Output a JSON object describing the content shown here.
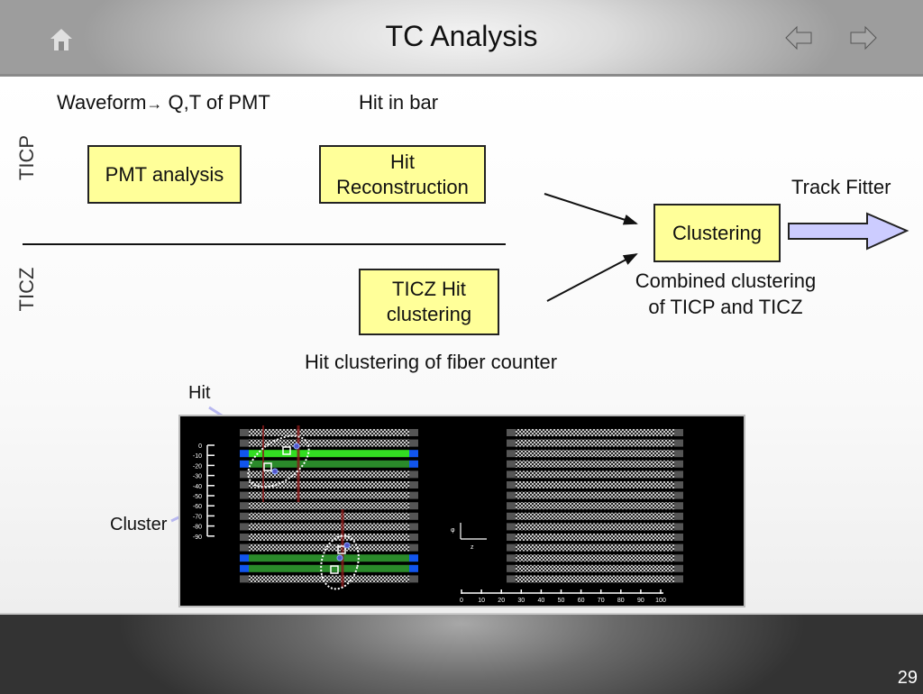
{
  "header": {
    "title": "TC Analysis",
    "home_icon": "home-icon",
    "prev_icon": "arrow-left-icon",
    "next_icon": "arrow-right-icon"
  },
  "labels": {
    "ticp": "TICP",
    "ticz": "TICZ",
    "waveform": "Waveform",
    "waveform_arrow": "→",
    "qt_of_pmt": "Q,T of PMT",
    "hit_in_bar": "Hit in bar",
    "track_fitter": "Track Fitter",
    "combined_line1": "Combined clustering",
    "combined_line2": "of TICP and TICZ",
    "fiber_counter": "Hit clustering of fiber counter",
    "hit_callout": "Hit",
    "cluster_callout": "Cluster"
  },
  "boxes": {
    "pmt_analysis": "PMT analysis",
    "hit_reco_line1": "Hit",
    "hit_reco_line2": "Reconstruction",
    "clustering": "Clustering",
    "ticz_line1": "TICZ Hit",
    "ticz_line2": "clustering"
  },
  "colors": {
    "box_fill": "#ffff99",
    "arrow_fill": "#ccccff",
    "hit_bar_green": "#33dd22",
    "pmt_blue": "#1155ee",
    "track_red": "#8b1a1a"
  },
  "event_display": {
    "left_axis_ticks": [
      "0",
      "-10",
      "-20",
      "-30",
      "-40",
      "-50",
      "-60",
      "-70",
      "-80",
      "-90"
    ],
    "bottom_axis_ticks": [
      "0",
      "10",
      "20",
      "30",
      "40",
      "50",
      "60",
      "70",
      "80",
      "90",
      "100"
    ],
    "axis_phi_label": "φ",
    "axis_z_label": "z",
    "left_panel_bar_count": 15,
    "right_panel_bar_count": 15,
    "hit_bars_left_panel": [
      2,
      3,
      12,
      13
    ]
  },
  "footer": {
    "page_number": "29"
  }
}
